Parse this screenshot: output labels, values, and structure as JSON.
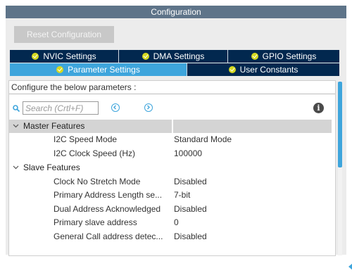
{
  "window": {
    "title": "Configuration"
  },
  "toolbar": {
    "reset_label": "Reset Configuration"
  },
  "tabs": {
    "row1": [
      {
        "label": "NVIC Settings",
        "status": "ok"
      },
      {
        "label": "DMA Settings",
        "status": "ok"
      },
      {
        "label": "GPIO Settings",
        "status": "ok"
      }
    ],
    "row2": [
      {
        "label": "Parameter Settings",
        "status": "ok",
        "active": true
      },
      {
        "label": "User Constants",
        "status": "ok",
        "active": false
      }
    ]
  },
  "content": {
    "instruction": "Configure the below parameters :",
    "search": {
      "placeholder": "Search (Crtl+F)",
      "value": ""
    },
    "groups": [
      {
        "name": "Master Features",
        "expanded": true,
        "params": [
          {
            "name": "I2C Speed Mode",
            "value": "Standard Mode"
          },
          {
            "name": "I2C Clock Speed (Hz)",
            "value": "100000"
          }
        ]
      },
      {
        "name": "Slave Features",
        "expanded": true,
        "params": [
          {
            "name": "Clock No Stretch Mode",
            "value": "Disabled"
          },
          {
            "name": "Primary Address Length se...",
            "value": "7-bit"
          },
          {
            "name": "Dual Address Acknowledged",
            "value": "Disabled"
          },
          {
            "name": "Primary slave address",
            "value": "0"
          },
          {
            "name": "General Call address detec...",
            "value": "Disabled"
          }
        ]
      }
    ]
  },
  "colors": {
    "title_bar": "#5e7489",
    "tab_inactive": "#02284f",
    "tab_active": "#3ea5dc",
    "status_ok": "#d6d91f",
    "scroll_thumb": "#3ea5dc"
  },
  "icons": {
    "search": "search-icon",
    "prev": "circle-chevron-left-icon",
    "next": "circle-chevron-right-icon",
    "info": "info-icon",
    "group_toggle": "chevron-down-icon",
    "tab_status": "check-circle-icon"
  }
}
